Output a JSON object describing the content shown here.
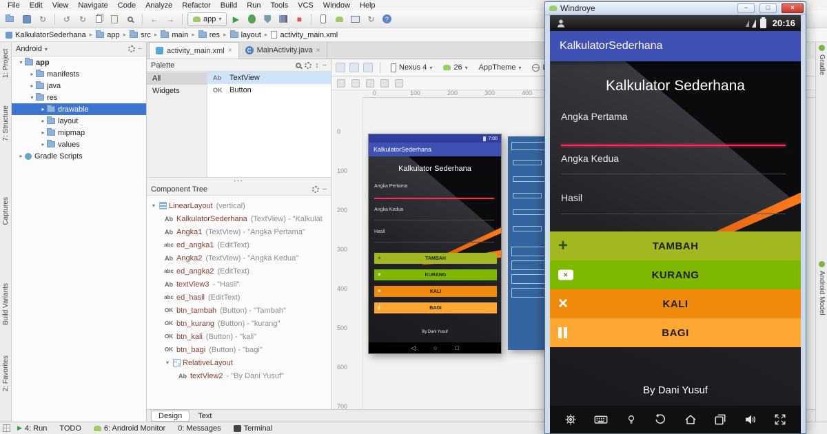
{
  "colors": {
    "action_bar": "#3f51b5",
    "status_bar": "#303f9f",
    "btn_tambah": "#a3b820",
    "btn_kurang": "#7fb800",
    "btn_kali": "#ef8a0c",
    "btn_bagi": "#ffa733",
    "accent_line": "#ff2d55",
    "selection_blue": "#3d74cd"
  },
  "icons": {
    "caret_down": "▾",
    "crumb_sep": "▸",
    "tree_open": "▾",
    "tree_closed": "▸",
    "play": "▶",
    "sync": "↻",
    "undo": "↺",
    "redo": "↻",
    "back": "←",
    "forward": "→",
    "stop": "■",
    "help": "?",
    "minimize": "−",
    "maximize": "□",
    "close": "×",
    "sort": "↕",
    "nav_back": "◁",
    "nav_home": "○",
    "nav_recents": "□",
    "plus": "+",
    "times": "×",
    "pause": "||",
    "textview_badge": "Ab",
    "edittext_badge": "abc",
    "button_badge": "OK"
  },
  "menu": {
    "items": [
      "File",
      "Edit",
      "View",
      "Navigate",
      "Code",
      "Analyze",
      "Refactor",
      "Build",
      "Run",
      "Tools",
      "VCS",
      "Window",
      "Help"
    ]
  },
  "toolbar": {
    "run_config": "app"
  },
  "breadcrumb": {
    "items": [
      "KalkulatorSederhana",
      "app",
      "src",
      "main",
      "res",
      "layout",
      "activity_main.xml"
    ]
  },
  "tool_tabs": {
    "left": [
      "1: Project",
      "7: Structure",
      "Captures",
      "Build Variants",
      "2: Favorites"
    ],
    "right": [
      "Gradle",
      "Android Model"
    ]
  },
  "project": {
    "view": "Android",
    "items": [
      {
        "label": "app"
      },
      {
        "label": "manifests"
      },
      {
        "label": "java"
      },
      {
        "label": "res"
      },
      {
        "label": "drawable"
      },
      {
        "label": "layout"
      },
      {
        "label": "mipmap"
      },
      {
        "label": "values"
      },
      {
        "label": "Gradle Scripts"
      }
    ]
  },
  "editor": {
    "tabs": [
      {
        "label": "activity_main.xml"
      },
      {
        "label": "MainActivity.java"
      }
    ],
    "bottom_tabs": [
      "Design",
      "Text"
    ]
  },
  "palette": {
    "title": "Palette",
    "groups": [
      "All",
      "Widgets"
    ],
    "widgets": [
      {
        "badge": "Ab",
        "label": "TextView"
      },
      {
        "badge": "OK",
        "label": "Button"
      }
    ]
  },
  "design_toolbar": {
    "device": "Nexus 4",
    "api": "26",
    "theme": "AppTheme",
    "lang": "Lan"
  },
  "component_tree": {
    "title": "Component Tree",
    "items": [
      {
        "name": "LinearLayout",
        "meta": "(vertical)"
      },
      {
        "name": "KalkulatorSederhana",
        "meta": "(TextView) - \"Kalkulat"
      },
      {
        "name": "Angka1",
        "meta": "(TextView) - \"Angka Pertama\""
      },
      {
        "name": "ed_angka1",
        "meta": "(EditText)"
      },
      {
        "name": "Angka2",
        "meta": "(TextView) - \"Angka Kedua\""
      },
      {
        "name": "ed_angka2",
        "meta": "(EditText)"
      },
      {
        "name": "textView3",
        "meta": "- \"Hasil\""
      },
      {
        "name": "ed_hasil",
        "meta": "(EditText)"
      },
      {
        "name": "btn_tambah",
        "meta": "(Button) - \"Tambah\""
      },
      {
        "name": "btn_kurang",
        "meta": "(Button) - \"kurang\""
      },
      {
        "name": "btn_kali",
        "meta": "(Button) - \"kali\""
      },
      {
        "name": "btn_bagi",
        "meta": "(Button) - \"bagi\""
      },
      {
        "name": "RelativeLayout",
        "meta": ""
      },
      {
        "name": "textView2",
        "meta": "- \"By Dani Yusuf\""
      }
    ]
  },
  "canvas": {
    "h_ruler": [
      "0",
      "100",
      "200",
      "300",
      "400"
    ],
    "v_ruler": [
      "0",
      "100",
      "200",
      "300",
      "400",
      "500",
      "600",
      "700"
    ]
  },
  "app": {
    "action_bar": "KalkulatorSederhana",
    "heading": "Kalkulator Sederhana",
    "label1": "Angka Pertama",
    "label2": "Angka Kedua",
    "label3": "Hasil",
    "buttons": [
      {
        "label": "TAMBAH"
      },
      {
        "label": "KURANG"
      },
      {
        "label": "KALI"
      },
      {
        "label": "BAGI"
      }
    ],
    "footer": "By Dani Yusuf",
    "preview_time": "7:00"
  },
  "emulator": {
    "title": "Windroye",
    "time": "20:16"
  },
  "status_bar": {
    "items": [
      "4: Run",
      "TODO",
      "6: Android Monitor",
      "0: Messages",
      "Terminal"
    ]
  }
}
